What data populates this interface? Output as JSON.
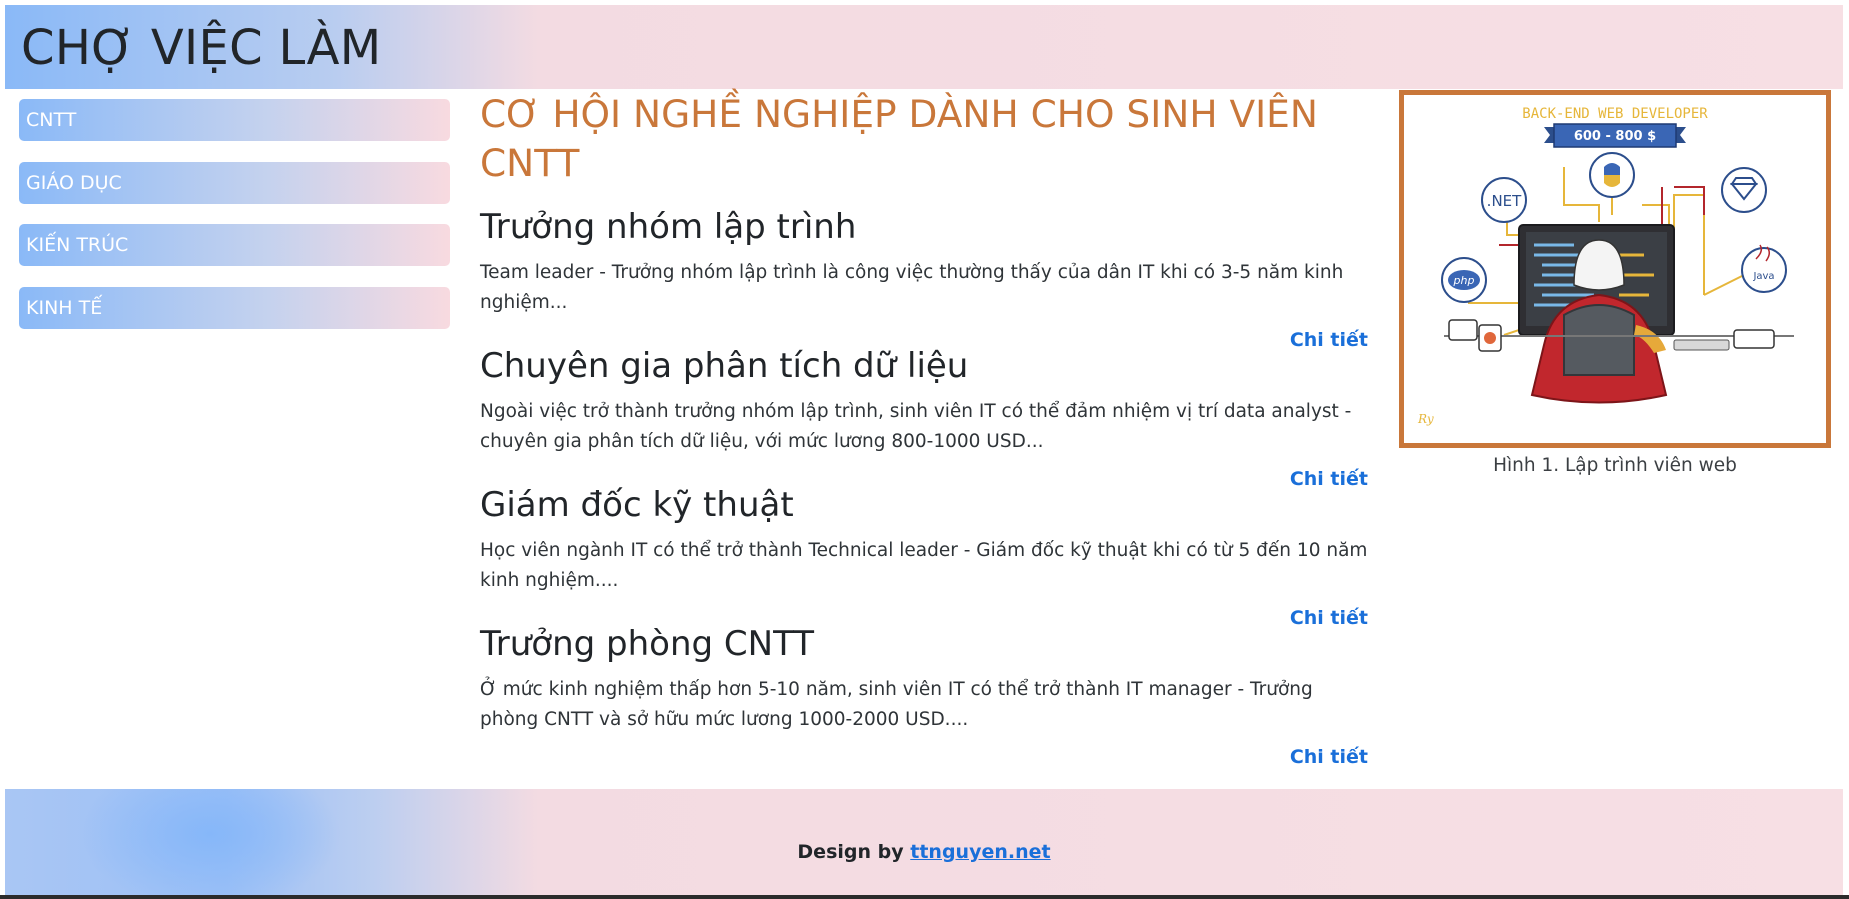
{
  "header": {
    "title": "CHỢ VIỆC LÀM"
  },
  "sidebar": {
    "items": [
      {
        "label": "CNTT"
      },
      {
        "label": "GIÁO DỤC"
      },
      {
        "label": "KIẾN TRÚC"
      },
      {
        "label": "KINH TẾ"
      }
    ]
  },
  "main": {
    "title": "CƠ HỘI NGHỀ NGHIỆP DÀNH CHO SINH VIÊN CNTT",
    "jobs": [
      {
        "title": "Trưởng nhóm lập trình",
        "description": "Team leader - Trưởng nhóm lập trình là công việc thường thấy của dân IT khi có 3-5 năm kinh nghiệm...",
        "link": "Chi tiết"
      },
      {
        "title": "Chuyên gia phân tích dữ liệu",
        "description": "Ngoài việc trở thành trưởng nhóm lập trình, sinh viên IT có thể đảm nhiệm vị trí data analyst - chuyên gia phân tích dữ liệu, với mức lương 800-1000 USD...",
        "link": "Chi tiết"
      },
      {
        "title": "Giám đốc kỹ thuật",
        "description": "Học viên ngành IT có thể trở thành Technical leader - Giám đốc kỹ thuật khi có từ 5 đến 10 năm kinh nghiệm....",
        "link": "Chi tiết"
      },
      {
        "title": "Trưởng phòng CNTT",
        "description": "Ở mức kinh nghiệm thấp hơn 5-10 năm, sinh viên IT có thể trở thành IT manager - Trưởng phòng CNTT và sở hữu mức lương 1000-2000 USD....",
        "link": "Chi tiết"
      }
    ]
  },
  "figure": {
    "banner": "BACK-END WEB DEVELOPER",
    "salary": "600 - 800 $",
    "badges": {
      "net": ".NET",
      "php": "php",
      "java": "Java"
    },
    "signature": "Ry",
    "caption": "Hình 1. Lập trình viên web"
  },
  "footer": {
    "prefix": "Design by",
    "link": "ttnguyen.net"
  },
  "colors": {
    "accent": "#c9773a",
    "link": "#1a6fd9",
    "gradient_blue": "#8ab9f7",
    "gradient_pink": "#f7dfe4"
  }
}
